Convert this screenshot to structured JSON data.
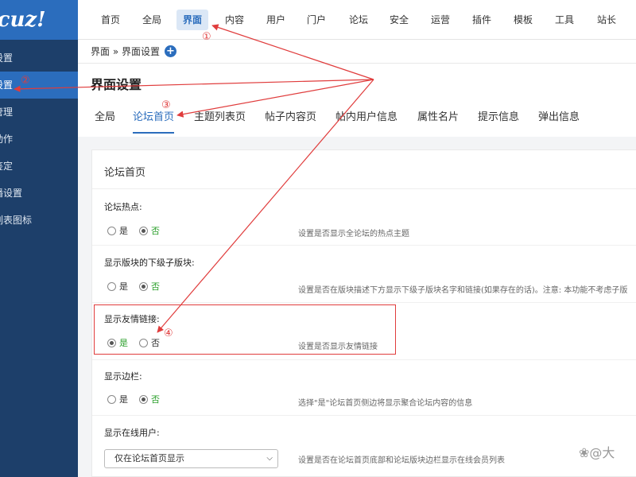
{
  "sidebar": {
    "logo": "scuz!",
    "items": [
      {
        "label": "设置",
        "active": false
      },
      {
        "label": "设置",
        "active": true
      },
      {
        "label": "管理",
        "active": false
      },
      {
        "label": "动作",
        "active": false
      },
      {
        "label": "鉴定",
        "active": false
      },
      {
        "label": "播设置",
        "active": false
      },
      {
        "label": "列表图标",
        "active": false
      }
    ]
  },
  "topnav": {
    "items": [
      "首页",
      "全局",
      "界面",
      "内容",
      "用户",
      "门户",
      "论坛",
      "安全",
      "运营",
      "插件",
      "模板",
      "工具",
      "站长"
    ],
    "active": "界面"
  },
  "breadcrumb": {
    "text": "界面 » 界面设置",
    "add_icon": "+"
  },
  "page_title": "界面设置",
  "tabs": {
    "items": [
      "全局",
      "论坛首页",
      "主题列表页",
      "帖子内容页",
      "帖内用户信息",
      "属性名片",
      "提示信息",
      "弹出信息"
    ],
    "active": "论坛首页"
  },
  "panel": {
    "title": "论坛首页",
    "yes": "是",
    "no": "否",
    "options": [
      {
        "label": "论坛热点:",
        "selected": "否",
        "desc": "设置是否显示全论坛的热点主题"
      },
      {
        "label": "显示版块的下级子版块:",
        "selected": "否",
        "desc": "设置是否在版块描述下方显示下级子版块名字和链接(如果存在的话)。注意: 本功能不考虑子版"
      },
      {
        "label": "显示友情链接:",
        "selected": "是",
        "desc": "设置是否显示友情链接"
      },
      {
        "label": "显示边栏:",
        "selected": "否",
        "desc": "选择\"是\"论坛首页侧边将显示聚合论坛内容的信息"
      },
      {
        "label": "显示在线用户:",
        "select_value": "仅在论坛首页显示",
        "desc": "设置是否在论坛首页底部和论坛版块边栏显示在线会员列表"
      }
    ]
  },
  "annotations": {
    "markers": [
      "①",
      "②",
      "③",
      "④"
    ],
    "color": "#e03c3c"
  },
  "watermark": "❀@大"
}
